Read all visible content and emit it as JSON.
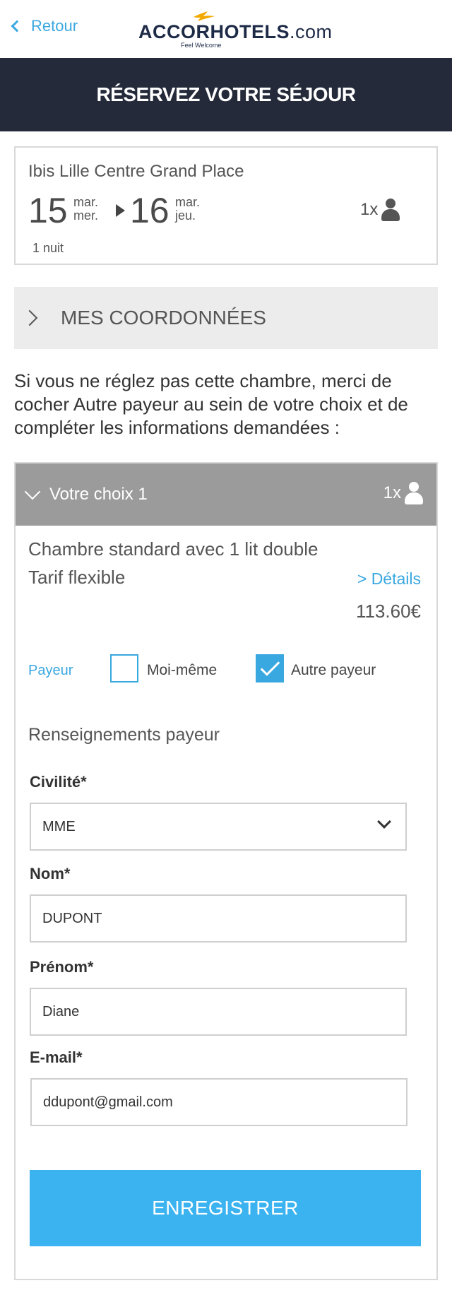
{
  "header": {
    "back_label": "Retour",
    "brand_accor": "ACCOR",
    "brand_hotels": "HOTELS",
    "brand_com": ".com",
    "tagline": "Feel Welcome",
    "banner_title": "RÉSERVEZ VOTRE SÉJOUR"
  },
  "summary": {
    "hotel_name": "Ibis Lille Centre Grand Place",
    "checkin_day": "15",
    "checkin_month": "mar.",
    "checkin_weekday": "mer.",
    "checkout_day": "16",
    "checkout_month": "mar.",
    "checkout_weekday": "jeu.",
    "guests": "1x",
    "nights": "1 nuit"
  },
  "coordinates_section": {
    "label": "MES COORDONNÉES"
  },
  "info_text": "Si vous ne réglez pas cette chambre, merci de cocher Autre payeur au sein de votre choix et de compléter les informations demandées :",
  "choice": {
    "title": "Votre choix 1",
    "qty": "1x",
    "room": "Chambre standard avec 1 lit double",
    "rate": "Tarif flexible",
    "details_link": "> Détails",
    "price": "113.60€",
    "payer_label": "Payeur",
    "option_self": "Moi-même",
    "option_other": "Autre payeur",
    "option_self_checked": false,
    "option_other_checked": true
  },
  "payer_form": {
    "section_title": "Renseignements payeur",
    "civility_label": "Civilité*",
    "civility_value": "MME",
    "lastname_label": "Nom*",
    "lastname_value": "DUPONT",
    "firstname_label": "Prénom*",
    "firstname_value": "Diane",
    "email_label": "E-mail*",
    "email_value": "ddupont@gmail.com",
    "submit_label": "ENREGISTRER"
  },
  "colors": {
    "accent": "#3aa8e0",
    "button": "#3bb3f1",
    "banner": "#242a3a",
    "choice_header": "#9b9b9b",
    "brand": "#1e2b47",
    "logo_bird": "#f2a900"
  }
}
